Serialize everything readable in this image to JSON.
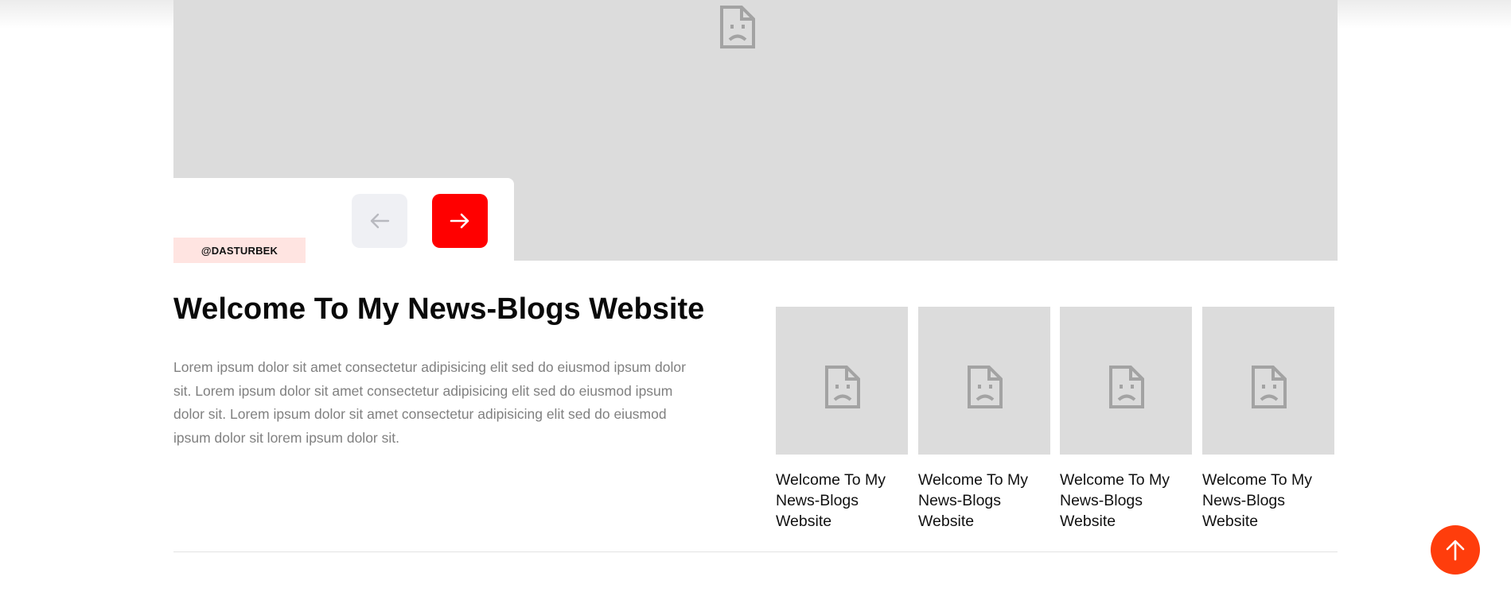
{
  "hero": {
    "tag": "@DASTURBEK",
    "prev_icon": "arrow-left-icon",
    "next_icon": "arrow-right-icon",
    "image_icon": "broken-image-icon"
  },
  "article": {
    "title": "Welcome To My News-Blogs Website",
    "description": "Lorem ipsum dolor sit amet consectetur adipisicing elit sed do eiusmod ipsum dolor sit. Lorem ipsum dolor sit amet consectetur adipisicing elit sed do eiusmod ipsum dolor sit. Lorem ipsum dolor sit amet consectetur adipisicing elit sed do eiusmod ipsum dolor sit lorem ipsum dolor sit."
  },
  "cards": [
    {
      "title": "Welcome To My News-Blogs Website"
    },
    {
      "title": "Welcome To My News-Blogs Website"
    },
    {
      "title": "Welcome To My News-Blogs Website"
    },
    {
      "title": "Welcome To My News-Blogs Website"
    }
  ],
  "scroll_top": {
    "icon": "arrow-up-icon"
  },
  "colors": {
    "accent_red": "#ff0000",
    "scroll_orange": "#ff3d0c",
    "tag_bg": "#ffe4e1",
    "placeholder_gray": "#dcdcdc"
  }
}
